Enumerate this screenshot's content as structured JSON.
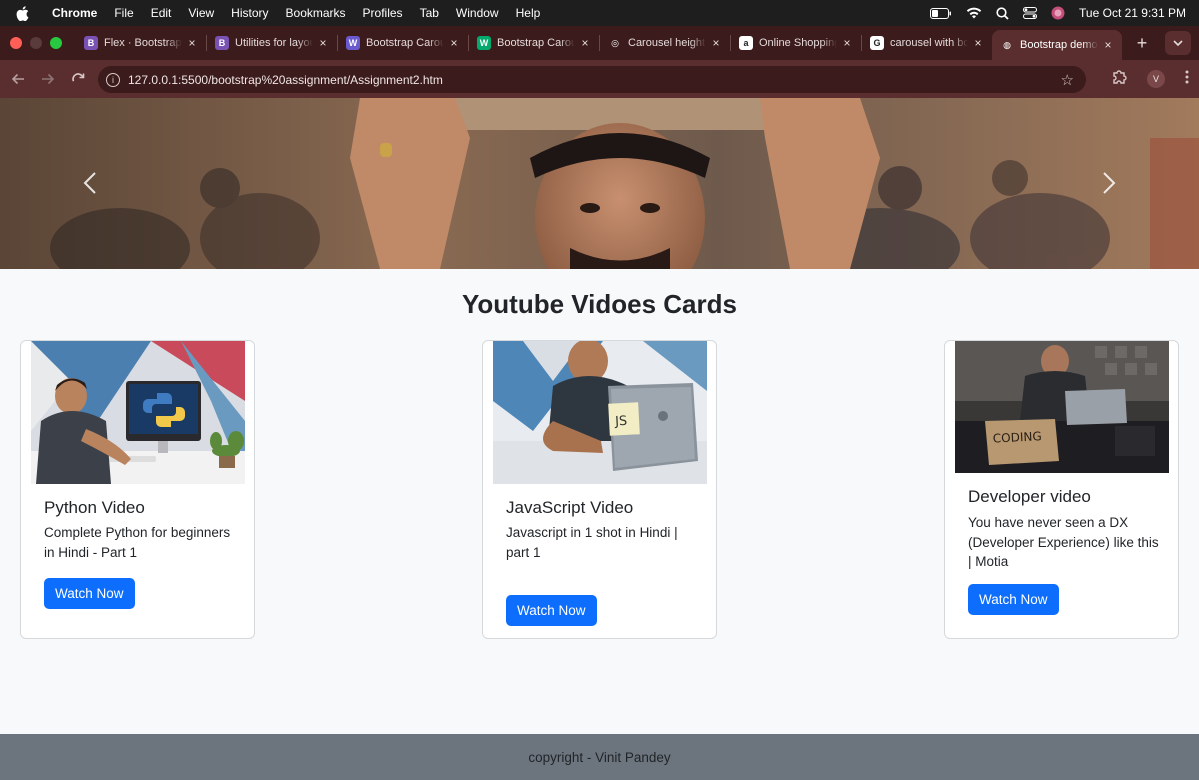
{
  "menubar": {
    "app": "Chrome",
    "items": [
      "File",
      "Edit",
      "View",
      "History",
      "Bookmarks",
      "Profiles",
      "Tab",
      "Window",
      "Help"
    ],
    "clock": "Tue Oct 21  9:31 PM"
  },
  "tabs": [
    {
      "title": "Flex · Bootstrap",
      "favicon": "bootstrap-icon",
      "color": "#7952b3",
      "glyph": "B"
    },
    {
      "title": "Utilities for layout",
      "favicon": "bootstrap-icon",
      "color": "#7952b3",
      "glyph": "B"
    },
    {
      "title": "Bootstrap Carousel",
      "favicon": "w3-icon",
      "color": "#6a5acd",
      "glyph": "W"
    },
    {
      "title": "Bootstrap Carousel",
      "favicon": "w-icon",
      "color": "#04aa6d",
      "glyph": "W"
    },
    {
      "title": "Carousel height",
      "favicon": "openai-icon",
      "color": "#3b1b1b",
      "glyph": "◎"
    },
    {
      "title": "Online Shopping",
      "favicon": "amazon-icon",
      "color": "#ffffff",
      "glyph": "a"
    },
    {
      "title": "carousel with bootstrap",
      "favicon": "google-icon",
      "color": "#ffffff",
      "glyph": "G"
    },
    {
      "title": "Bootstrap demo",
      "favicon": "globe-icon",
      "color": "#5a2e2e",
      "glyph": "◍",
      "active": true
    }
  ],
  "address": {
    "url": "127.0.0.1:5500/bootstrap%20assignment/Assignment2.htm",
    "profile_initial": "V"
  },
  "page": {
    "heading": "Youtube Vidoes Cards",
    "cards": [
      {
        "title": "Python Video",
        "text": "Complete Python for beginners in Hindi - Part 1",
        "button": "Watch Now"
      },
      {
        "title": "JavaScript Video",
        "text": "Javascript in 1 shot in Hindi | part 1",
        "button": "Watch Now"
      },
      {
        "title": "Developer video",
        "text": "You have never seen a DX (Developer Experience) like this | Motia",
        "button": "Watch Now"
      }
    ],
    "footer": "copyright - Vinit Pandey"
  },
  "colors": {
    "primary": "#0d6efd",
    "footer_bg": "#6c757d",
    "browser_frame": "#5a2e2e"
  }
}
